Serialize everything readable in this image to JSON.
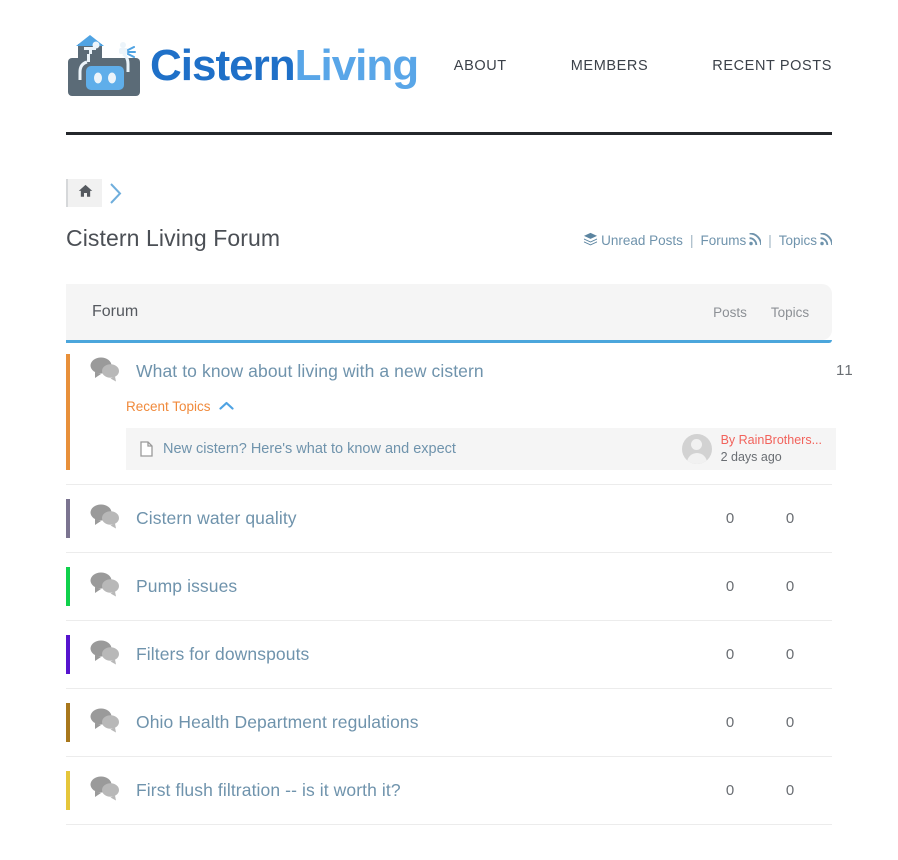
{
  "site": {
    "brand_part1": "Cistern",
    "brand_part2": "Living",
    "logo_icon": "cistern-tank-icon"
  },
  "nav": {
    "items": [
      {
        "label": "ABOUT"
      },
      {
        "label": "MEMBERS"
      },
      {
        "label": "RECENT POSTS"
      }
    ]
  },
  "breadcrumb": {
    "home_icon": "home-icon",
    "separator_icon": "chevron-right-icon"
  },
  "page": {
    "title": "Cistern Living Forum"
  },
  "feeds": {
    "stack_icon": "layers-icon",
    "unread_label": "Unread Posts",
    "sep1": "|",
    "forums_label": "Forums",
    "forums_rss_icon": "rss-icon",
    "sep2": "|",
    "topics_label": "Topics",
    "topics_rss_icon": "rss-icon"
  },
  "table": {
    "headers": {
      "forum": "Forum",
      "posts": "Posts",
      "topics": "Topics"
    },
    "accent_line_color": "#4BA6DC",
    "rows": [
      {
        "title": "What to know about living with a new cistern",
        "accent": "#E8903A",
        "posts": "1",
        "topics": "1",
        "icon": "speech-bubbles-icon",
        "expanded": true,
        "recent_topics_label": "Recent Topics",
        "recent_topics_chevron": "chevron-up-icon",
        "topic": {
          "doc_icon": "document-icon",
          "title": "New cistern? Here's what to know and expect",
          "avatar_icon": "user-avatar-icon",
          "author": "By RainBrothers...",
          "time": "2 days ago"
        }
      },
      {
        "title": "Cistern water quality",
        "accent": "#7B7490",
        "posts": "0",
        "topics": "0",
        "icon": "speech-bubbles-icon",
        "expanded": false
      },
      {
        "title": "Pump issues",
        "accent": "#0FD14C",
        "posts": "0",
        "topics": "0",
        "icon": "speech-bubbles-icon",
        "expanded": false
      },
      {
        "title": "Filters for downspouts",
        "accent": "#5614CE",
        "posts": "0",
        "topics": "0",
        "icon": "speech-bubbles-icon",
        "expanded": false
      },
      {
        "title": "Ohio Health Department regulations",
        "accent": "#A8771C",
        "posts": "0",
        "topics": "0",
        "icon": "speech-bubbles-icon",
        "expanded": false
      },
      {
        "title": "First flush filtration -- is it worth it?",
        "accent": "#E5C63A",
        "posts": "0",
        "topics": "0",
        "icon": "speech-bubbles-icon",
        "expanded": false
      }
    ]
  },
  "colors": {
    "brand_dark_blue": "#1F70C8",
    "brand_light_blue": "#59A6E8",
    "link_steel": "#6f93ac",
    "orange_link": "#F08A3C",
    "author_red": "#F2635C"
  }
}
